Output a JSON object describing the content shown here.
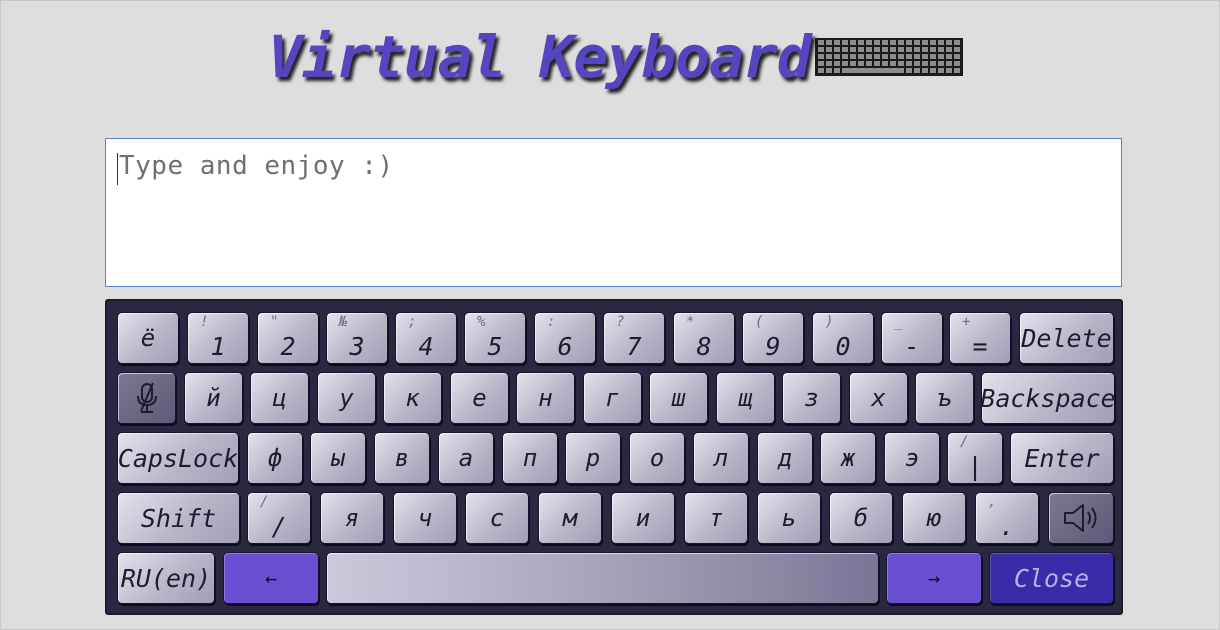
{
  "header": {
    "title": "Virtual Keyboard",
    "icon": "keyboard-icon"
  },
  "textarea": {
    "value": "",
    "placeholder": "Type and enjoy :)"
  },
  "keyboard": {
    "row1": [
      {
        "main": "ё",
        "shift": ""
      },
      {
        "main": "1",
        "shift": "!"
      },
      {
        "main": "2",
        "shift": "\""
      },
      {
        "main": "3",
        "shift": "№"
      },
      {
        "main": "4",
        "shift": ";"
      },
      {
        "main": "5",
        "shift": "%"
      },
      {
        "main": "6",
        "shift": ":"
      },
      {
        "main": "7",
        "shift": "?"
      },
      {
        "main": "8",
        "shift": "*"
      },
      {
        "main": "9",
        "shift": "("
      },
      {
        "main": "0",
        "shift": ")"
      },
      {
        "main": "-",
        "shift": "_"
      },
      {
        "main": "=",
        "shift": "+"
      },
      {
        "main": "Delete",
        "shift": ""
      }
    ],
    "row2": [
      "й",
      "ц",
      "у",
      "к",
      "е",
      "н",
      "г",
      "ш",
      "щ",
      "з",
      "х",
      "ъ",
      "Backspace"
    ],
    "row3": {
      "caps": "CapsLock",
      "letters": [
        "ф",
        "ы",
        "в",
        "а",
        "п",
        "р",
        "о",
        "л",
        "д",
        "ж",
        "э"
      ],
      "slash_main": "|",
      "slash_shift": "/",
      "enter": "Enter"
    },
    "row4": {
      "shift": "Shift",
      "slash_main": "/",
      "slash_shift": "/",
      "letters": [
        "я",
        "ч",
        "с",
        "м",
        "и",
        "т",
        "ь",
        "б",
        "ю"
      ],
      "dot_main": ".",
      "dot_shift": ","
    },
    "row5": {
      "lang": "RU(en)",
      "left": "←",
      "right": "→",
      "close": "Close"
    },
    "icons": {
      "mic": "microphone-off-icon",
      "sound": "speaker-icon"
    },
    "colors": {
      "accent": "#6a4fd2",
      "close": "#3b2aa8",
      "frame": "#2a2840",
      "title": "#5546c0"
    }
  }
}
